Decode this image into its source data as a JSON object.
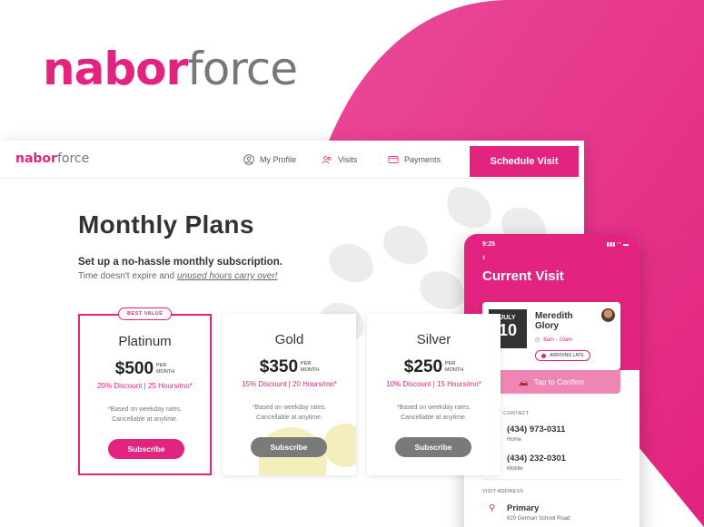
{
  "brand": {
    "logo_main": "nabor",
    "logo_accent": "force",
    "accent_color": "#e2237f"
  },
  "nav": {
    "items": [
      {
        "label": "My Profile",
        "icon": "profile-icon"
      },
      {
        "label": "Visits",
        "icon": "users-icon"
      },
      {
        "label": "Payments",
        "icon": "card-icon"
      }
    ],
    "cta": "Schedule Visit"
  },
  "page": {
    "title": "Monthly Plans",
    "subtitle": "Set up a no-hassle monthly subscription.",
    "note_prefix": "Time doesn't expire and ",
    "note_link": "unused hours carry over!"
  },
  "plans": [
    {
      "badge": "BEST VALUE",
      "name": "Platinum",
      "price": "$500",
      "per": "PER",
      "period": "MONTH",
      "discount": "20% Discount  |  25 Hours/mo*",
      "note1": "*Based on weekday rates.",
      "note2": "Cancellable at anytime.",
      "button": "Subscribe"
    },
    {
      "name": "Gold",
      "price": "$350",
      "per": "PER",
      "period": "MONTH",
      "discount": "15% Discount  |  20 Hours/mo*",
      "note1": "*Based on weekday rates.",
      "note2": "Cancellable at anytime.",
      "button": "Subscribe"
    },
    {
      "name": "Silver",
      "price": "$250",
      "per": "PER",
      "period": "MONTH",
      "discount": "10% Discount  |  15 Hours/mo*",
      "note1": "*Based on weekday rates.",
      "note2": "Cancellable at anytime.",
      "button": "Subscribe"
    }
  ],
  "phone": {
    "time": "9:25",
    "title": "Current Visit",
    "visit": {
      "month": "JULY",
      "day": "10",
      "name": "Meredith Glory",
      "time_range": "8am - 10am",
      "status": "ARRIVING LATE"
    },
    "confirm": "Tap to Confirm",
    "client_contact_label": "CLIENT CONTACT",
    "contacts": [
      {
        "number": "(434) 973-0311",
        "type": "Home"
      },
      {
        "number": "(434) 232-0301",
        "type": "Mobile"
      }
    ],
    "visit_address_label": "VISIT ADDRESS",
    "address": {
      "name": "Primary",
      "line": "620 German School Road"
    }
  }
}
